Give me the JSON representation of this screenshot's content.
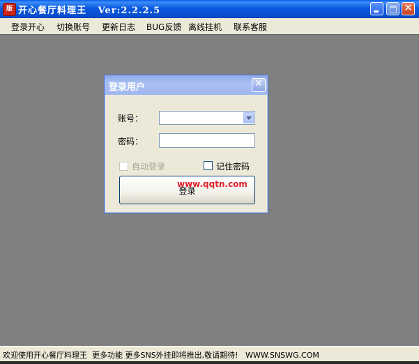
{
  "window": {
    "title": "开心餐厅料理王   Ver:2.2.2.5",
    "icon_text": "版"
  },
  "menu": [
    "登录开心",
    "切换账号",
    "更新日志",
    "BUG反馈",
    "离线挂机",
    "联系客服"
  ],
  "dialog": {
    "title": "登录用户",
    "account_label": "账号：",
    "account_value": "",
    "password_label": "密码：",
    "password_value": "",
    "auto_login_label": "自动登录",
    "auto_login_checked": false,
    "remember_password_label": "记住密码",
    "remember_password_checked": false,
    "login_button": "登录",
    "watermark": "www.qqtn.com"
  },
  "status": {
    "text": "欢迎使用开心餐厅料理王  更多功能 更多SNS外挂即将推出,敬请期待!   WWW.SNSWG.COM"
  },
  "colors": {
    "titlebar": "#0a59e0",
    "client_bg": "#808080",
    "dialog_bg": "#ece9d8",
    "watermark": "#e0202a"
  },
  "icons": [
    "app-icon",
    "minimize-icon",
    "maximize-icon",
    "close-icon",
    "dropdown-arrow-icon"
  ]
}
